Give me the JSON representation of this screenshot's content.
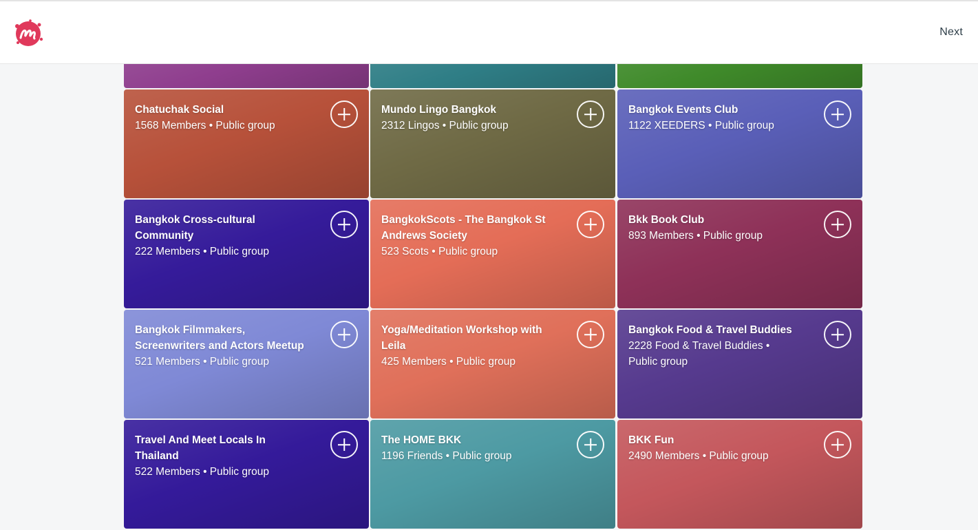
{
  "header": {
    "next_label": "Next",
    "logo_icon": "meetup-logo-icon",
    "brand_color": "#e0395b"
  },
  "partial_row": [
    {
      "color": "#8f3e8e"
    },
    {
      "color": "#2f7e86"
    },
    {
      "color": "#3f8a2a"
    }
  ],
  "groups": [
    {
      "name": "Chatuchak Social",
      "meta": "1568 Members • Public group",
      "color": "#b7513a"
    },
    {
      "name": "Mundo Lingo Bangkok",
      "meta": "2312 Lingos • Public group",
      "color": "#6f6a45"
    },
    {
      "name": "Bangkok Events Club",
      "meta": "1122 XEEDERS • Public group",
      "color": "#5a5fb8"
    },
    {
      "name": "Bangkok Cross-cultural Community",
      "meta": "222 Members • Public group",
      "color": "#351b9a"
    },
    {
      "name": "BangkokScots - The Bangkok St Andrews Society",
      "meta": "523 Scots • Public group",
      "color": "#e46d57"
    },
    {
      "name": "Bkk Book Club",
      "meta": "893 Members • Public group",
      "color": "#8e3158"
    },
    {
      "name": "Bangkok Filmmakers, Screenwriters and Actors Meetup",
      "meta": "521 Members • Public group",
      "color": "#7f89d6"
    },
    {
      "name": "Yoga/Meditation Workshop with Leila",
      "meta": "425 Members • Public group",
      "color": "#e0705a"
    },
    {
      "name": "Bangkok Food & Travel Buddies",
      "meta": "2228 Food & Travel Buddies • Public group",
      "color": "#563a8e"
    },
    {
      "name": "Travel And Meet Locals In Thailand",
      "meta": "522 Members • Public group",
      "color": "#341a9a"
    },
    {
      "name": "The HOME BKK",
      "meta": "1196 Friends • Public group",
      "color": "#4d9aa3"
    },
    {
      "name": "BKK Fun",
      "meta": "2490 Members • Public group",
      "color": "#c4575c"
    }
  ],
  "icons": {
    "join": "plus-circle-icon"
  }
}
